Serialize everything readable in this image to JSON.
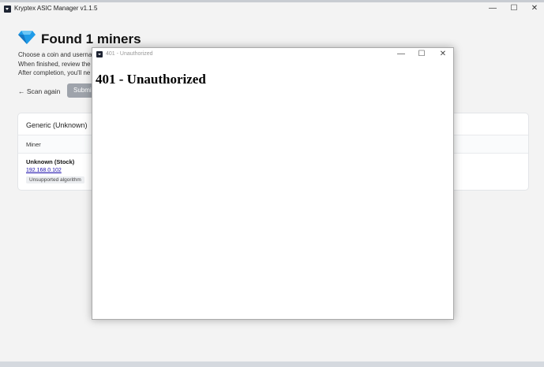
{
  "app": {
    "window_title": "Kryptex ASIC Manager v1.1.5",
    "controls": {
      "minimize": "—",
      "maximize": "☐",
      "close": "✕"
    }
  },
  "page": {
    "heading": "Found 1 miners",
    "icon": "diamond-icon",
    "paragraphs": [
      "Choose a coin and userna",
      "When finished, review the",
      "After completion, you'll ne"
    ],
    "scan_again": "← Scan again",
    "submit": "Submit"
  },
  "card": {
    "title": "Generic (Unknown)",
    "column_miner": "Miner",
    "miner_name": "Unknown (Stock)",
    "miner_ip": "192.168.0.102",
    "algorithm_badge": "Unsupported algorithm"
  },
  "dialog": {
    "window_title": "401 - Unauthorized",
    "heading": "401 - Unauthorized",
    "controls": {
      "minimize": "—",
      "maximize": "☐",
      "close": "✕"
    }
  },
  "colors": {
    "accent": "#1e9be8",
    "submit_bg": "#9ea3ab",
    "link": "#1a0dab"
  }
}
